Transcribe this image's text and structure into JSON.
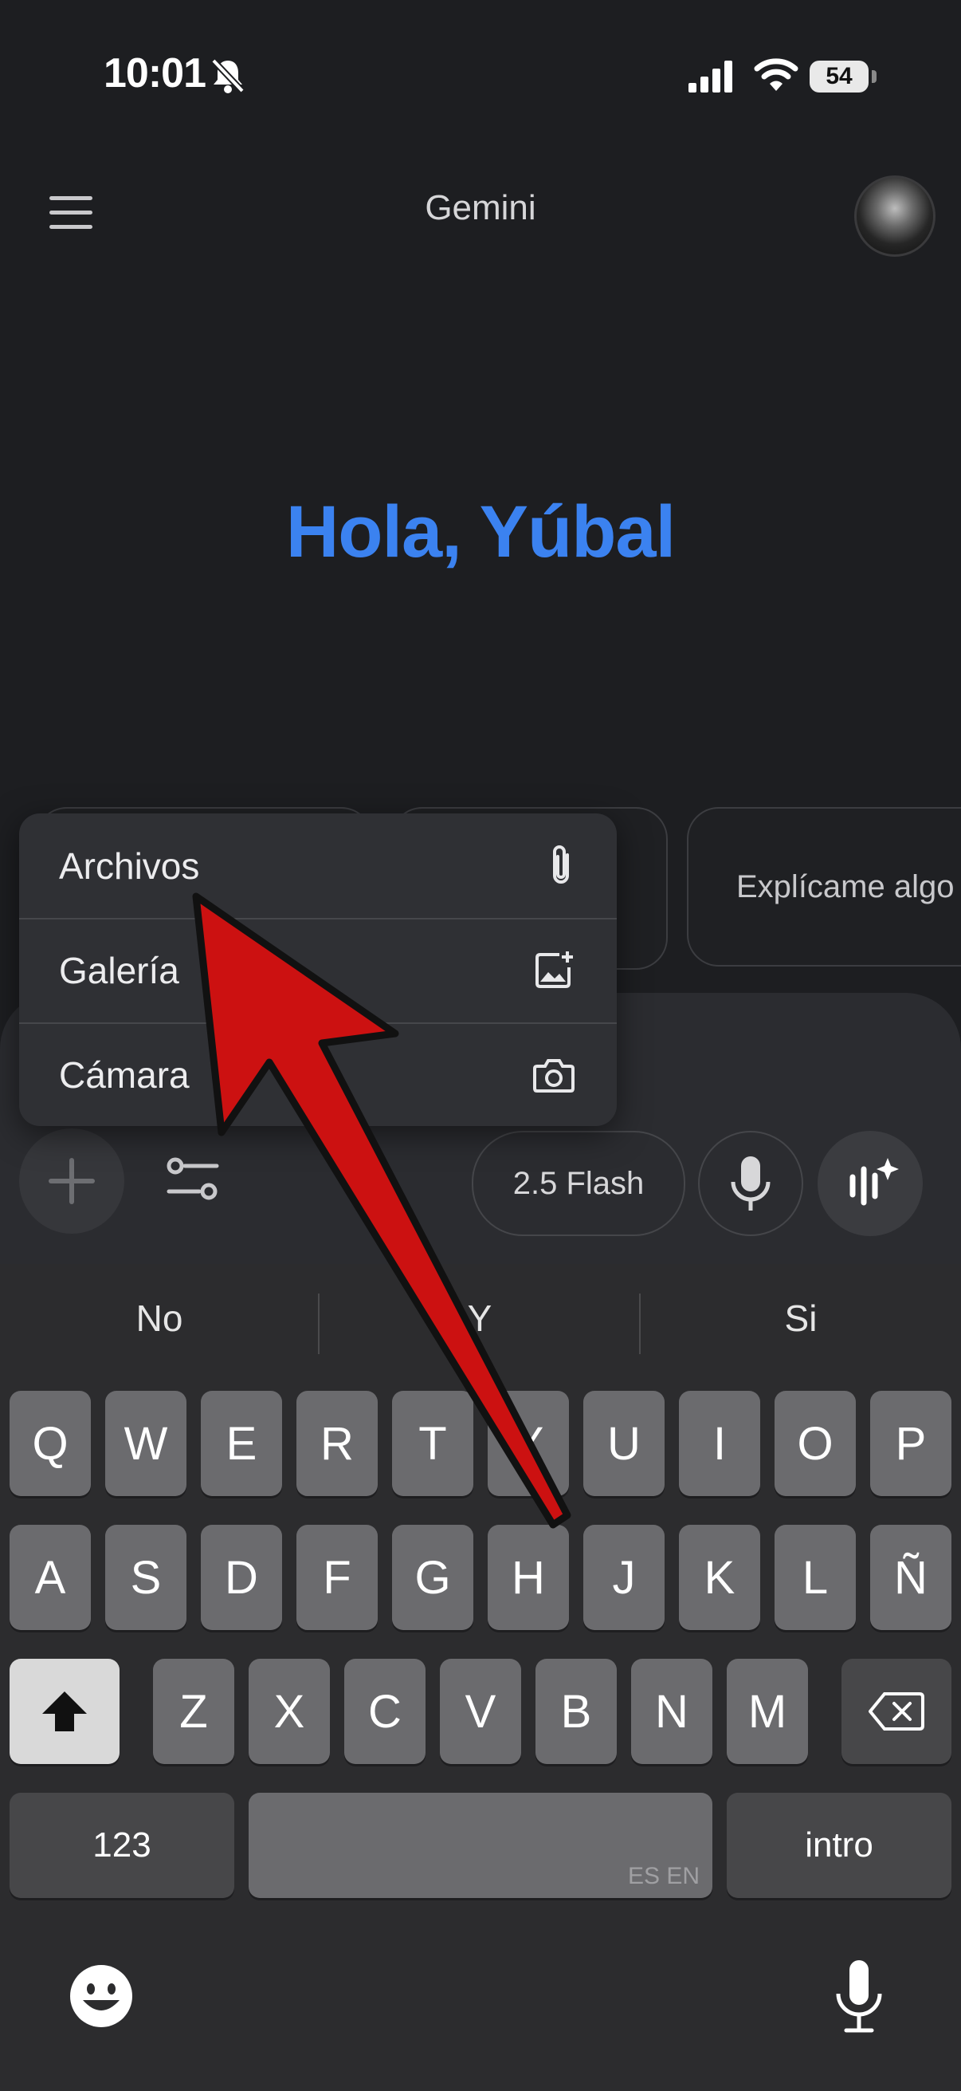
{
  "status_bar": {
    "time": "10:01",
    "battery": "54"
  },
  "header": {
    "title": "Gemini"
  },
  "greeting": "Hola, Yúbal",
  "suggestions": [
    "",
    "",
    "Explícame algo"
  ],
  "attach_menu": {
    "items": [
      {
        "label": "Archivos",
        "icon": "paperclip-icon"
      },
      {
        "label": "Galería",
        "icon": "gallery-add-icon"
      },
      {
        "label": "Cámara",
        "icon": "camera-icon"
      }
    ]
  },
  "composer": {
    "model_label": "2.5 Flash"
  },
  "keyboard": {
    "suggestions": [
      "No",
      "Y",
      "Si"
    ],
    "row1": [
      "Q",
      "W",
      "E",
      "R",
      "T",
      "Y",
      "U",
      "I",
      "O",
      "P"
    ],
    "row2": [
      "A",
      "S",
      "D",
      "F",
      "G",
      "H",
      "J",
      "K",
      "L",
      "Ñ"
    ],
    "row3": [
      "Z",
      "X",
      "C",
      "V",
      "B",
      "N",
      "M"
    ],
    "numbers_label": "123",
    "space_lang": "ES EN",
    "return_label": "intro"
  },
  "colors": {
    "accent": "#3b82f0",
    "arrow": "#cc1111",
    "background": "#1d1e21"
  }
}
